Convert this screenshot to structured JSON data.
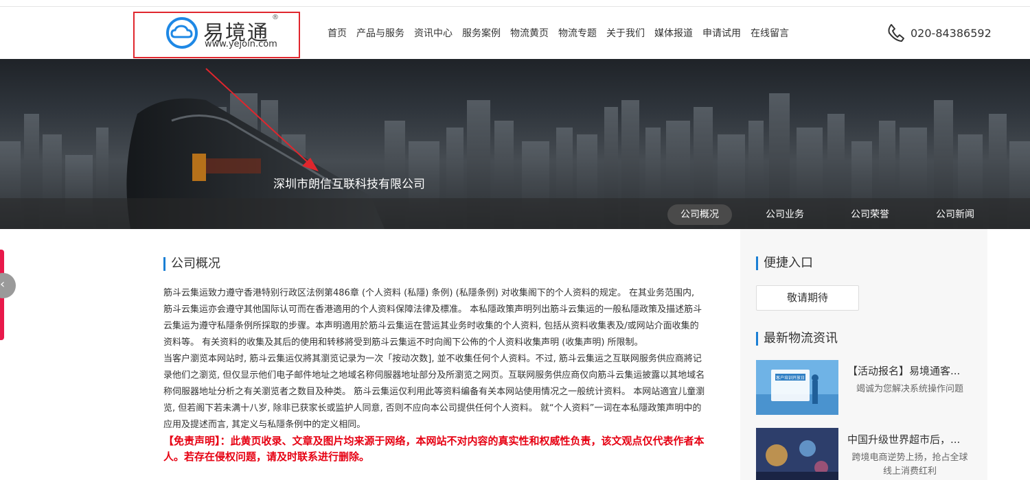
{
  "header": {
    "logo_text": "易境通",
    "logo_reg": "®",
    "logo_url": "www.yejoin.com",
    "nav": [
      "首页",
      "产品与服务",
      "资讯中心",
      "服务案例",
      "物流黄页",
      "物流专题",
      "关于我们",
      "媒体报道",
      "申请试用",
      "在线留言"
    ],
    "phone": "020-84386592"
  },
  "banner": {
    "company_name": "深圳市朗信互联科技有限公司",
    "tabs": [
      "公司概况",
      "公司业务",
      "公司荣誉",
      "公司新闻"
    ],
    "active_tab": "公司概况"
  },
  "main": {
    "section_title": "公司概况",
    "paragraphs": [
      "筋斗云集运致力遵守香港特别行政区法例第486章 (个人资料 (私隱) 条例) (私隱条例) 对收集阁下的个人资料的规定。 在其业务范围内, 筋斗云集运亦会遵守其他国际认可而在香港適用的个人资料保障法律及標准。 本私隱政策声明列出筋斗云集运的一般私隱政策及描述筋斗云集运为遵守私隱条例所採取的步骤。本声明適用於筋斗云集运在营运其业务时收集的个人资料, 包括从资料收集表及/或网站介面收集的资料等。 有关资料的收集及其后的使用和转移將受到筋斗云集运不时向阁下公佈的个人资料收集声明 (收集声明) 所限制。",
      "当客户瀏览本网站时, 筋斗云集运仅將其瀏览记录为一次「按动次数], 並不收集任何个人资料。不过, 筋斗云集运之互联网服务供应商將记录他们之瀏览, 但仅显示他们电子邮件地址之地域名称伺服器地址部分及所瀏览之网页。互联网服务供应商仅向筋斗云集运披露以其地域名称伺服器地址分析之有关瀏览者之数目及种类。 筋斗云集运仅利用此等资料编备有关本网站使用情况之一般统计资料。 本网站適宜儿童瀏览, 但若阁下若未满十八岁, 除非已获家长或监护人同意, 否则不应向本公司提供任何个人资料。 就“个人资料”一词在本私隱政策声明中的应用及提述而言, 其定义与私隱条例中的定义相同。"
    ],
    "disclaimer": "【免责声明】：此黄页收录、文章及图片均来源于网络，本网站不对内容的真实性和权威性负责，该文观点仅代表作者本人。若存在侵权问题，请及时联系进行删除。"
  },
  "sidebar": {
    "quick_title": "便捷入口",
    "quick_button": "敬请期待",
    "news_title": "最新物流资讯",
    "news": [
      {
        "title": "【活动报名】易境通客...",
        "desc_lines": [
          "竭诚为您解决系统操作问题"
        ],
        "thumb_text": "客户培训开放日"
      },
      {
        "title": "中国升级世界超市后，...",
        "desc_lines": [
          "跨境电商逆势上扬，抢占全球",
          "线上消费红利"
        ]
      }
    ]
  },
  "colors": {
    "accent": "#1a7fd4",
    "highlight_box": "#e0262d",
    "disclaimer": "#e60012",
    "float_bar": "#e8194a"
  },
  "icons": [
    "logo-cloud-icon",
    "phone-icon",
    "chevron-left-icon"
  ]
}
